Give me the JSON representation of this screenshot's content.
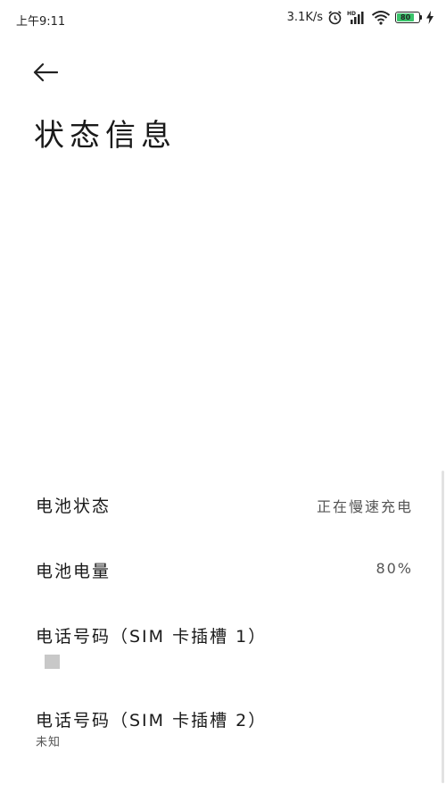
{
  "status_bar": {
    "time": "上午9:11",
    "net_speed": "3.1K/s",
    "battery_level": "80",
    "icons": [
      "alarm-icon",
      "signal-hd-icon",
      "wifi-icon",
      "battery-icon",
      "charging-icon"
    ]
  },
  "header": {
    "back_icon": "arrow-left-icon",
    "title": "状态信息"
  },
  "rows": [
    {
      "title": "电池状态",
      "value": "正在慢速充电"
    },
    {
      "title": "电池电量",
      "value": "80%"
    },
    {
      "title": "电话号码（SIM 卡插槽 1）",
      "sub": ""
    },
    {
      "title": "电话号码（SIM 卡插槽 2）",
      "sub": "未知"
    }
  ],
  "colors": {
    "battery_fill": "#39c36a",
    "text_primary": "#1a1a1a",
    "text_secondary": "#555555"
  }
}
